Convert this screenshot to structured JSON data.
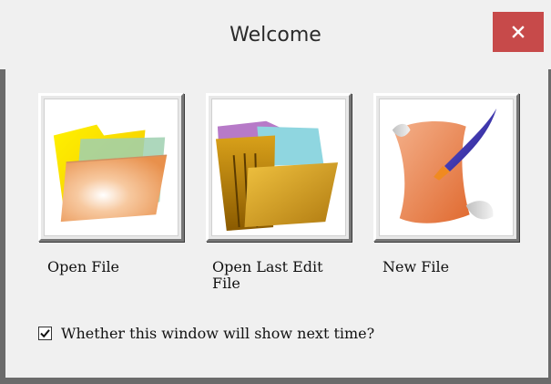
{
  "window": {
    "title": "Welcome",
    "close_icon": "close-icon",
    "accent_close": "#c74a4a"
  },
  "options": [
    {
      "label": "Open File",
      "icon": "folder-icon"
    },
    {
      "label": "Open Last Edit File",
      "icon": "folder-files-icon"
    },
    {
      "label": "New File",
      "icon": "scroll-quill-icon"
    }
  ],
  "show_next_time": {
    "label": "Whether this window will show next time?",
    "checked": true
  }
}
